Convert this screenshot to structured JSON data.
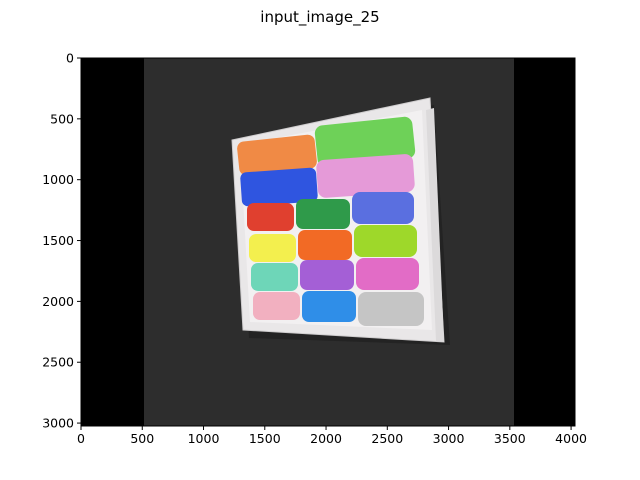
{
  "figure": {
    "title": "input_image_25"
  },
  "axes": {
    "xlim": [
      0,
      4032
    ],
    "ylim": [
      3024,
      0
    ],
    "x_ticks": [
      0,
      500,
      1000,
      1500,
      2000,
      2500,
      3000,
      3500,
      4000
    ],
    "y_ticks": [
      0,
      500,
      1000,
      1500,
      2000,
      2500,
      3000
    ],
    "x_tick_labels": [
      "0",
      "500",
      "1000",
      "1500",
      "2000",
      "2500",
      "3000",
      "3500",
      "4000"
    ],
    "y_tick_labels": [
      "0",
      "500",
      "1000",
      "1500",
      "2000",
      "2500",
      "3000"
    ]
  },
  "image": {
    "description_colors": {
      "background": "#141414",
      "photo_bg": "#2e2e2e",
      "tray": "#e9e7e8",
      "cars": [
        "#f08a45",
        "#6ed158",
        "#2f55e0",
        "#e59ad8",
        "#e0402f",
        "#2f9a4a",
        "#5a6fe0",
        "#f3ef4e",
        "#f26a25",
        "#9ed82a",
        "#6ed6b8",
        "#a45fd6",
        "#e26cc6",
        "#f2b0c0",
        "#2f8ee8",
        "#c5c5c5"
      ]
    }
  }
}
